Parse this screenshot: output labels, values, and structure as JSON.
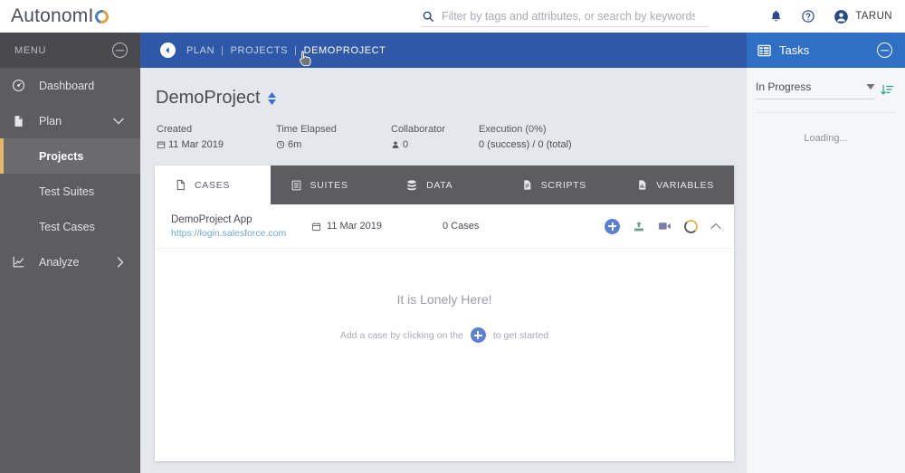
{
  "brand": {
    "name_primary": "Autonom",
    "name_suffix": "I",
    "logo_icon": "autonomiq-q-logo"
  },
  "search": {
    "placeholder": "Filter by tags and attributes, or search by keywords",
    "value": "",
    "icon": "search-icon"
  },
  "topbar": {
    "notifications_icon": "bell-icon",
    "help_icon": "help-circle-icon",
    "user_icon": "account-circle-icon",
    "user_name": "TARUN"
  },
  "sidebar": {
    "header_label": "MENU",
    "collapse_icon": "minus-circle-icon",
    "items": [
      {
        "label": "Dashboard",
        "icon": "dashboard-gauge-icon",
        "active": false,
        "sub": false,
        "chevron": ""
      },
      {
        "label": "Plan",
        "icon": "document-icon",
        "active": false,
        "sub": false,
        "chevron": "chevron-down-icon"
      },
      {
        "label": "Projects",
        "icon": "",
        "active": true,
        "sub": true,
        "chevron": ""
      },
      {
        "label": "Test Suites",
        "icon": "",
        "active": false,
        "sub": true,
        "chevron": ""
      },
      {
        "label": "Test Cases",
        "icon": "",
        "active": false,
        "sub": true,
        "chevron": ""
      },
      {
        "label": "Analyze",
        "icon": "chart-line-icon",
        "active": false,
        "sub": false,
        "chevron": "chevron-right-icon"
      }
    ]
  },
  "breadcrumb": {
    "back_icon": "back-arrow-circle-icon",
    "items": [
      "PLAN",
      "PROJECTS",
      "DEMOPROJECT"
    ],
    "separator": "|",
    "current_index": 2
  },
  "project": {
    "title": "DemoProject",
    "title_stepper_icon": "sort-updown-icon",
    "meta": [
      {
        "label": "Created",
        "value": "11 Mar 2019",
        "icon": "calendar-icon"
      },
      {
        "label": "Time Elapsed",
        "value": "6m",
        "icon": "clock-icon"
      },
      {
        "label": "Collaborator",
        "value": "0",
        "icon": "person-icon"
      },
      {
        "label": "Execution (0%)",
        "value": "0 (success) / 0 (total)",
        "icon": ""
      }
    ]
  },
  "tabs": [
    {
      "label": "CASES",
      "icon": "file-icon",
      "active": true
    },
    {
      "label": "SUITES",
      "icon": "list-box-icon",
      "active": false
    },
    {
      "label": "DATA",
      "icon": "database-icon",
      "active": false
    },
    {
      "label": "SCRIPTS",
      "icon": "script-file-icon",
      "active": false
    },
    {
      "label": "VARIABLES",
      "icon": "variables-file-icon",
      "active": false
    }
  ],
  "case_row": {
    "name": "DemoProject App",
    "url": "https://login.salesforce.com",
    "date": "11 Mar 2019",
    "date_icon": "calendar-icon",
    "count": "0 Cases",
    "actions": [
      {
        "icon": "add-plus-circle-icon"
      },
      {
        "icon": "upload-icon"
      },
      {
        "icon": "video-camera-icon"
      },
      {
        "icon": "progress-ring-icon"
      },
      {
        "icon": "chevron-up-icon"
      }
    ]
  },
  "empty_state": {
    "headline": "It is Lonely Here!",
    "hint_before": "Add a case by clicking on the",
    "hint_icon": "add-plus-circle-icon",
    "hint_after": "to get started"
  },
  "tasks_panel": {
    "title": "Tasks",
    "title_icon": "task-list-icon",
    "collapse_icon": "minus-circle-icon",
    "filter_value": "In Progress",
    "filter_caret_icon": "caret-down-icon",
    "sort_icon": "sort-descending-icon",
    "status_text": "Loading..."
  },
  "colors": {
    "breadcrumb_blue": "#2f58a7",
    "tasks_blue": "#2f6fc4",
    "sidebar_gray": "#5d5d61",
    "accent_orange": "#e8b66a",
    "plus_blue": "#5b7fd4",
    "sort_teal": "#2e9e92",
    "link_blue": "#6fa8c9",
    "page_bg": "#e4e7ec"
  }
}
